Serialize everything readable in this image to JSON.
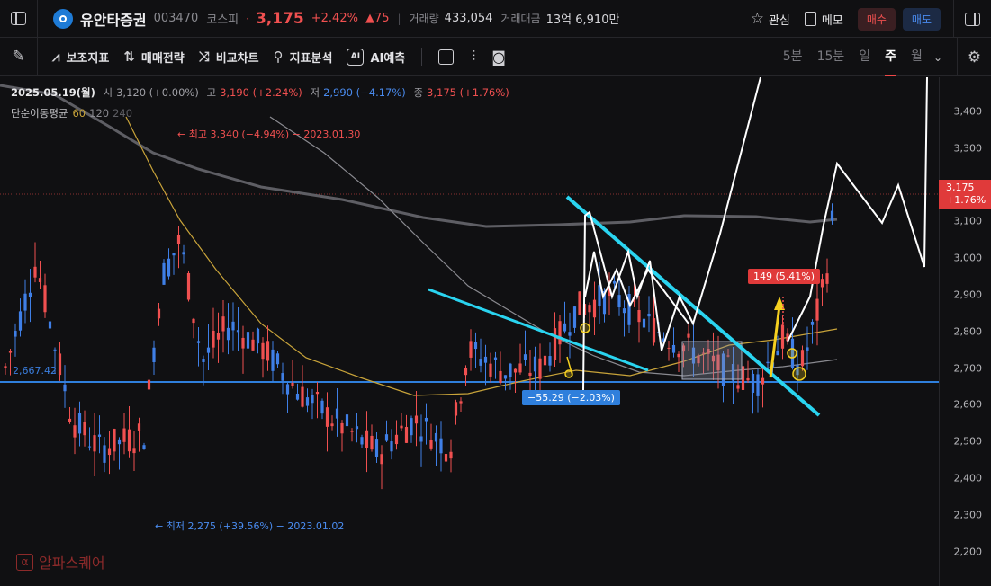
{
  "header": {
    "name": "유안타증권",
    "code": "003470",
    "market": "코스피",
    "price": "3,175",
    "change_pct": "+2.42%",
    "change": "▲75",
    "volume_label": "거래량",
    "volume": "433,054",
    "amount_label": "거래대금",
    "amount": "13억 6,910만",
    "watch_label": "관심",
    "memo_label": "메모",
    "buy_label": "매수",
    "sell_label": "매도"
  },
  "toolbar": {
    "tools": [
      "보조지표",
      "매매전략",
      "비교차트",
      "지표분석",
      "AI예측"
    ],
    "ai_icon_text": "AI",
    "periods": [
      "5분",
      "15분",
      "일",
      "주",
      "월"
    ],
    "active_period": "주"
  },
  "legend": {
    "date": "2025.05.19(월)",
    "open_label": "시",
    "open": "3,120 (+0.00%)",
    "high_label": "고",
    "high": "3,190 (+2.24%)",
    "low_label": "저",
    "low": "2,990 (−4.17%)",
    "close_label": "종",
    "close": "3,175 (+1.76%)",
    "ma_label": "단순이동평균",
    "ma60": "60",
    "ma120": "120",
    "ma240": "240"
  },
  "annotations": {
    "high_text": "← 최고 3,340 (−4.94%) − 2023.01.30",
    "low_text": "← 최저 2,275 (+39.56%) − 2023.01.02",
    "hline_label": "2,667.42",
    "measure_up": "149 (5.41%)",
    "measure_down": "−55.29 (−2.03%)",
    "last_price": "3,175",
    "last_pct": "+1.76%"
  },
  "axis": {
    "ticks": [
      "3,400",
      "3,300",
      "3,200",
      "3,100",
      "3,000",
      "2,900",
      "2,800",
      "2,700",
      "2,600",
      "2,500",
      "2,400",
      "2,300",
      "2,200"
    ]
  },
  "colors": {
    "up": "#f05050",
    "down": "#3f7fe6",
    "ma60": "#c9a43a",
    "ma120": "#8a8a90",
    "ma240": "#5e5e64",
    "trend": "#2ad4f0",
    "hline": "#2f7fdc"
  },
  "watermark": {
    "text": "알파스퀘어",
    "icon_text": "α"
  }
}
